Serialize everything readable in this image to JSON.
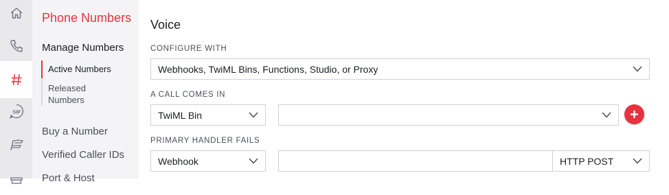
{
  "rail": {
    "icons": [
      "home-icon",
      "phone-icon",
      "hash-icon",
      "sip-icon",
      "wings-icon",
      "archive-icon"
    ],
    "sip_text": "SIP"
  },
  "nav": {
    "title": "Phone Numbers",
    "manage": "Manage Numbers",
    "active_numbers": "Active Numbers",
    "released_numbers": "Released Numbers",
    "buy_number": "Buy a Number",
    "verified_caller_ids": "Verified Caller IDs",
    "port_host": "Port & Host"
  },
  "voice": {
    "heading": "Voice",
    "configure_with_label": "CONFIGURE WITH",
    "configure_with_value": "Webhooks, TwiML Bins, Functions, Studio, or Proxy",
    "call_comes_in_label": "A CALL COMES IN",
    "call_type_value": "TwiML Bin",
    "call_bin_value": "",
    "primary_handler_fails_label": "PRIMARY HANDLER FAILS",
    "fail_type_value": "Webhook",
    "fail_url_value": "",
    "fail_method_value": "HTTP POST"
  },
  "colors": {
    "accent": "#e7323f",
    "rail_bg": "#e9e9ec",
    "nav_bg": "#f4f4f6"
  }
}
